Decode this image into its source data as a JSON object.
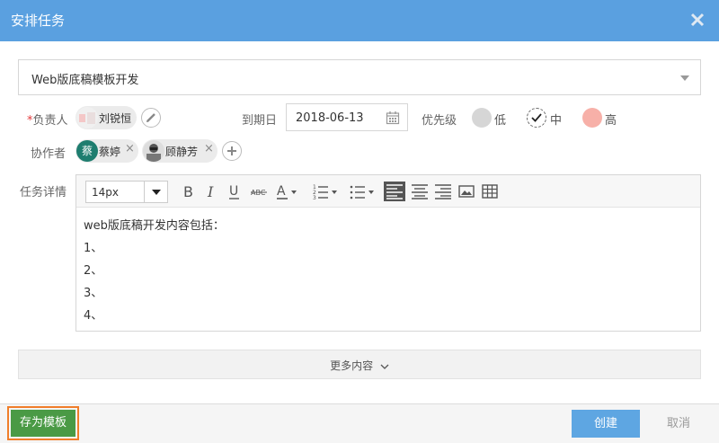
{
  "dialog": {
    "title": "安排任务"
  },
  "task": {
    "name": "Web版底稿模板开发"
  },
  "assignee": {
    "required_mark": "*",
    "label": "负责人",
    "name": "刘锐恒"
  },
  "due": {
    "label": "到期日",
    "value": "2018-06-13"
  },
  "priority": {
    "label": "优先级",
    "options": [
      {
        "label": "低",
        "color": "#d6d6d6",
        "selected": false
      },
      {
        "label": "中",
        "color": "#ffffff",
        "selected": true
      },
      {
        "label": "高",
        "color": "#f7b0a8",
        "selected": false
      }
    ]
  },
  "collaborators": {
    "label": "协作者",
    "items": [
      {
        "avatar_text": "蔡",
        "avatar_color": "#1e7d6f",
        "name": "蔡婷"
      },
      {
        "avatar_text": "",
        "avatar_color": "#888888",
        "name": "顾静芳"
      }
    ]
  },
  "details": {
    "label": "任务详情",
    "font_size": "14px",
    "lines": [
      "web版底稿开发内容包括：",
      "1、",
      "2、",
      "3、",
      "4、"
    ]
  },
  "more": {
    "label": "更多内容"
  },
  "footer": {
    "save_template": "存为模板",
    "create": "创建",
    "cancel": "取消"
  },
  "colors": {
    "header": "#5aa0e0",
    "save_button": "#4a9a45",
    "save_highlight": "#f07e2a",
    "create_button": "#5ea6e2",
    "required": "#e4393c"
  }
}
